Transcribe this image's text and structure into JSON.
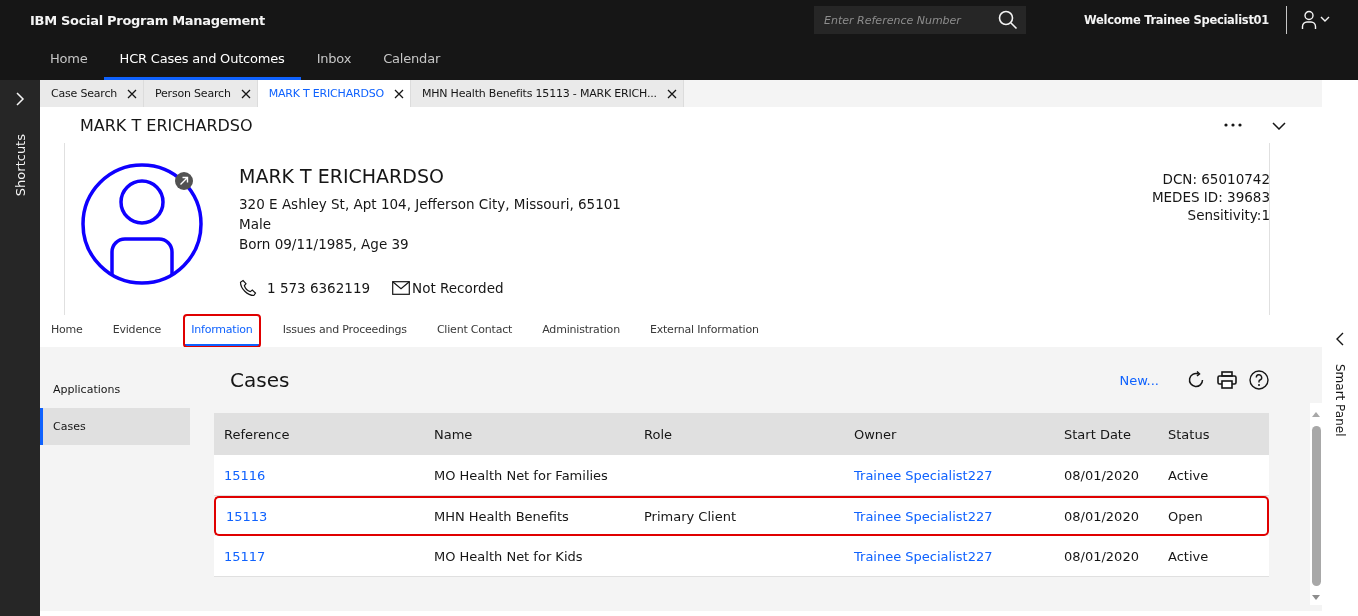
{
  "header": {
    "product": "IBM Social Program Management",
    "search": {
      "placeholder": "Enter Reference Number"
    },
    "welcome": "Welcome Trainee Specialist01"
  },
  "nav": [
    {
      "label": "Home",
      "selected": false
    },
    {
      "label": "HCR Cases and Outcomes",
      "selected": true
    },
    {
      "label": "Inbox",
      "selected": false
    },
    {
      "label": "Calendar",
      "selected": false
    }
  ],
  "shortcuts": {
    "label": "Shortcuts"
  },
  "open_tabs": [
    {
      "label": "Case Search",
      "selected": false
    },
    {
      "label": "Person Search",
      "selected": false
    },
    {
      "label": "MARK T ERICHARDSO",
      "selected": true
    },
    {
      "label": "MHN Health Benefits 15113 - MARK ERICH...",
      "selected": false
    }
  ],
  "person": {
    "page_title": "MARK T ERICHARDSO",
    "name": "MARK T ERICHARDSO",
    "address": "320 E Ashley St, Apt 104, Jefferson City, Missouri, 65101",
    "gender": "Male",
    "born": "Born 09/11/1985, Age 39",
    "phone": "1 573 6362119",
    "email": "Not Recorded",
    "ids": [
      "DCN: 65010742",
      "MEDES ID: 39683",
      "Sensitivity:1"
    ]
  },
  "sub_tabs": [
    {
      "label": "Home",
      "selected": false,
      "highlighted": false
    },
    {
      "label": "Evidence",
      "selected": false,
      "highlighted": false
    },
    {
      "label": "Information",
      "selected": true,
      "highlighted": true
    },
    {
      "label": "Issues and Proceedings",
      "selected": false,
      "highlighted": false
    },
    {
      "label": "Client Contact",
      "selected": false,
      "highlighted": false
    },
    {
      "label": "Administration",
      "selected": false,
      "highlighted": false
    },
    {
      "label": "External Information",
      "selected": false,
      "highlighted": false
    }
  ],
  "side_nav": [
    {
      "label": "Applications",
      "selected": false
    },
    {
      "label": "Cases",
      "selected": true
    }
  ],
  "cases": {
    "title": "Cases",
    "new_link": "New...",
    "columns": [
      "Reference",
      "Name",
      "Role",
      "Owner",
      "Start Date",
      "Status"
    ],
    "rows": [
      {
        "reference": "15116",
        "name": "MO Health Net for Families",
        "role": "",
        "owner": "Trainee Specialist227",
        "start_date": "08/01/2020",
        "status": "Active",
        "highlighted": false
      },
      {
        "reference": "15113",
        "name": "MHN Health Benefits",
        "role": "Primary Client",
        "owner": "Trainee Specialist227",
        "start_date": "08/01/2020",
        "status": "Open",
        "highlighted": true
      },
      {
        "reference": "15117",
        "name": "MO Health Net for Kids",
        "role": "",
        "owner": "Trainee Specialist227",
        "start_date": "08/01/2020",
        "status": "Active",
        "highlighted": false
      }
    ]
  },
  "smart_panel": {
    "label": "Smart Panel"
  }
}
